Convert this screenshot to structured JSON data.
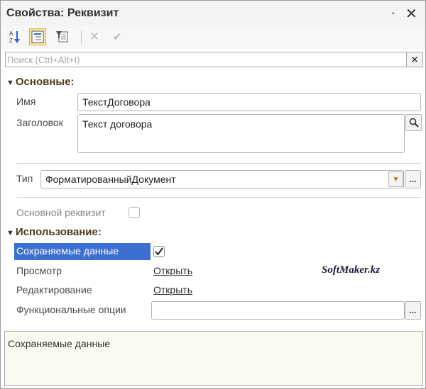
{
  "window": {
    "title": "Свойства: Реквизит",
    "pin_glyph": "▪",
    "close_glyph": "✕"
  },
  "toolbar": {
    "sort_az_glyph": "A↓Z",
    "categories_glyph": "▤",
    "filter_glyph": "▼",
    "delete_glyph": "✕",
    "check_glyph": "✔"
  },
  "search": {
    "placeholder": "Поиск (Ctrl+Alt+I)",
    "value": "",
    "clear_glyph": "✕"
  },
  "section_main": {
    "title": "Основные:"
  },
  "name": {
    "label": "Имя",
    "value": "ТекстДоговора"
  },
  "heading": {
    "label": "Заголовок",
    "value": "Текст договора"
  },
  "type": {
    "label": "Тип",
    "value": "ФорматированныйДокумент",
    "dropdown_glyph": "▼",
    "more_glyph": "..."
  },
  "main_attr": {
    "label": "Основной реквизит",
    "checked": false
  },
  "section_use": {
    "title": "Использование:"
  },
  "saved_data": {
    "label": "Сохраняемые данные",
    "checked": true
  },
  "view": {
    "label": "Просмотр",
    "link": "Открыть"
  },
  "edit": {
    "label": "Редактирование",
    "link": "Открыть"
  },
  "func_options": {
    "label": "Функциональные опции",
    "value": "",
    "more_glyph": "..."
  },
  "watermark": "SoftMaker.kz",
  "description": {
    "text": "Сохраняемые данные"
  }
}
